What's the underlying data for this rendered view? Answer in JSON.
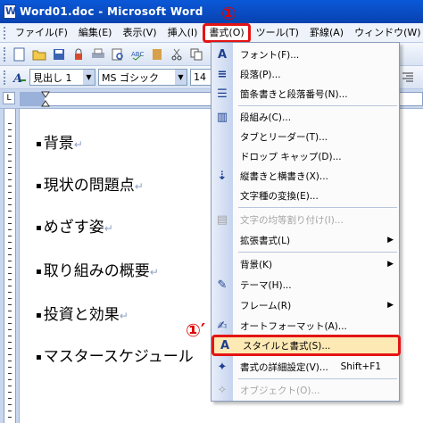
{
  "window": {
    "title": "Word01.doc - Microsoft Word"
  },
  "annotations": {
    "marker_top": "①",
    "marker_item": "①′"
  },
  "menubar": {
    "items": [
      {
        "label": "ファイル(F)"
      },
      {
        "label": "編集(E)"
      },
      {
        "label": "表示(V)"
      },
      {
        "label": "挿入(I)"
      },
      {
        "label": "書式(O)"
      },
      {
        "label": "ツール(T)"
      },
      {
        "label": "罫線(A)"
      },
      {
        "label": "ウィンドウ(W)"
      }
    ]
  },
  "toolbar": {
    "style_value": "見出し 1",
    "font_value": "MS ゴシック",
    "size_value": "14"
  },
  "ruler": {
    "tab_label": "L"
  },
  "document": {
    "bullet": "▪",
    "para_mark": "↵",
    "lines": [
      "背景",
      "現状の問題点",
      "めざす姿",
      "取り組みの概要",
      "投資と効果",
      "マスタースケジュール"
    ]
  },
  "format_menu": {
    "items": [
      {
        "label": "フォント(F)...",
        "icon": "A"
      },
      {
        "label": "段落(P)...",
        "icon": "≡"
      },
      {
        "label": "箇条書きと段落番号(N)...",
        "icon": "☰"
      },
      {
        "label": "段組み(C)...",
        "icon": "▥"
      },
      {
        "label": "タブとリーダー(T)..."
      },
      {
        "label": "ドロップ キャップ(D)..."
      },
      {
        "label": "縦書きと横書き(X)...",
        "icon": "⇣"
      },
      {
        "label": "文字種の変換(E)..."
      },
      {
        "label": "文字の均等割り付け(I)...",
        "icon": "▤"
      },
      {
        "label": "拡張書式(L)"
      },
      {
        "label": "背景(K)"
      },
      {
        "label": "テーマ(H)...",
        "icon": "✎"
      },
      {
        "label": "フレーム(R)"
      },
      {
        "label": "オートフォーマット(A)...",
        "icon": "✍"
      },
      {
        "label": "スタイルと書式(S)...",
        "icon": "A"
      },
      {
        "label": "書式の詳細設定(V)...",
        "icon": "✦",
        "shortcut": "Shift+F1"
      },
      {
        "label": "オブジェクト(O)...",
        "icon": "✧"
      }
    ]
  }
}
